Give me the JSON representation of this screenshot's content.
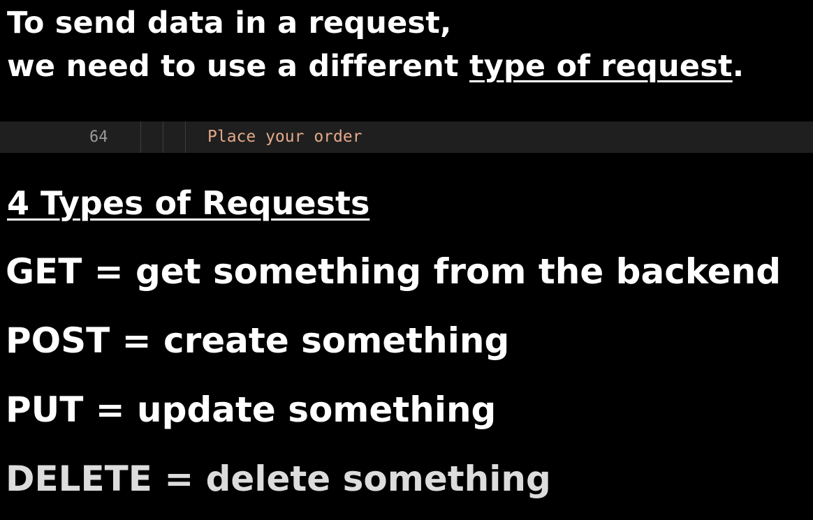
{
  "headline": {
    "line1": "To send data in a request,",
    "line2_prefix": "we need to use a different ",
    "line2_emphasis": "type of request",
    "line2_suffix": "."
  },
  "code_line": {
    "line_number": "64",
    "text": "Place your order",
    "text_color": "#e4a98a"
  },
  "section_title": "4 Types of Requests",
  "request_types": [
    {
      "text": "GET = get something from the backend"
    },
    {
      "text": "POST = create something"
    },
    {
      "text": "PUT = update something"
    },
    {
      "text": "DELETE = delete something"
    }
  ]
}
